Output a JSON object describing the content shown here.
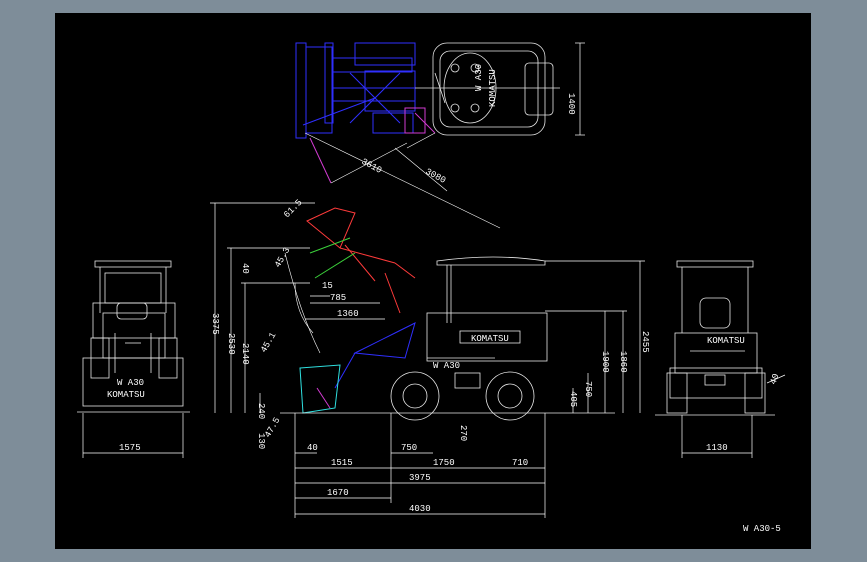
{
  "drawing": {
    "title": "W A30-5",
    "background": "#000000",
    "frame_color": "#7e8d99",
    "colors": {
      "blue": "#2f2fff",
      "red": "#ff3b3b",
      "magenta": "#d23bd2",
      "green": "#3bd23b",
      "cyan": "#2fe0e0",
      "white": "#ffffff"
    }
  },
  "top_view": {
    "brand": "KOMATSU",
    "model": "W A30",
    "dims": {
      "width": "1400",
      "turn_outer": "3610",
      "turn_inner": "3080"
    }
  },
  "front_view": {
    "model": "W A30",
    "brand": "KOMATSU",
    "dims": {
      "track_width": "1575"
    }
  },
  "rear_view": {
    "brand": "KOMATSU",
    "dims": {
      "width": "1130",
      "angle": "40"
    }
  },
  "side_view": {
    "brand": "KOMATSU",
    "model": "W A30",
    "vertical_dims": {
      "overall_raised": "3375",
      "pin_height": "2530",
      "dump_clearance": "2140",
      "top_small": "40",
      "cab_height": "2455",
      "hood_height": "1900",
      "body_height": "1860",
      "axle_height": "750",
      "ground_clearance": "405",
      "bucket_low": "240",
      "dig_depth": "130",
      "front_small": "270"
    },
    "horizontal_dims": {
      "dump_reach": "785",
      "reach_low": "1360",
      "reach_small": "15",
      "bucket_front": "40",
      "front_overhang": "750",
      "d1515": "1515",
      "wheelbase": "1750",
      "rear_overhang": "710",
      "d3975": "3975",
      "d1670": "1670",
      "overall_length": "4030"
    },
    "angles": {
      "a1": "61.5",
      "a2": "45.3",
      "a3": "45.1",
      "a4": "47.5"
    }
  }
}
